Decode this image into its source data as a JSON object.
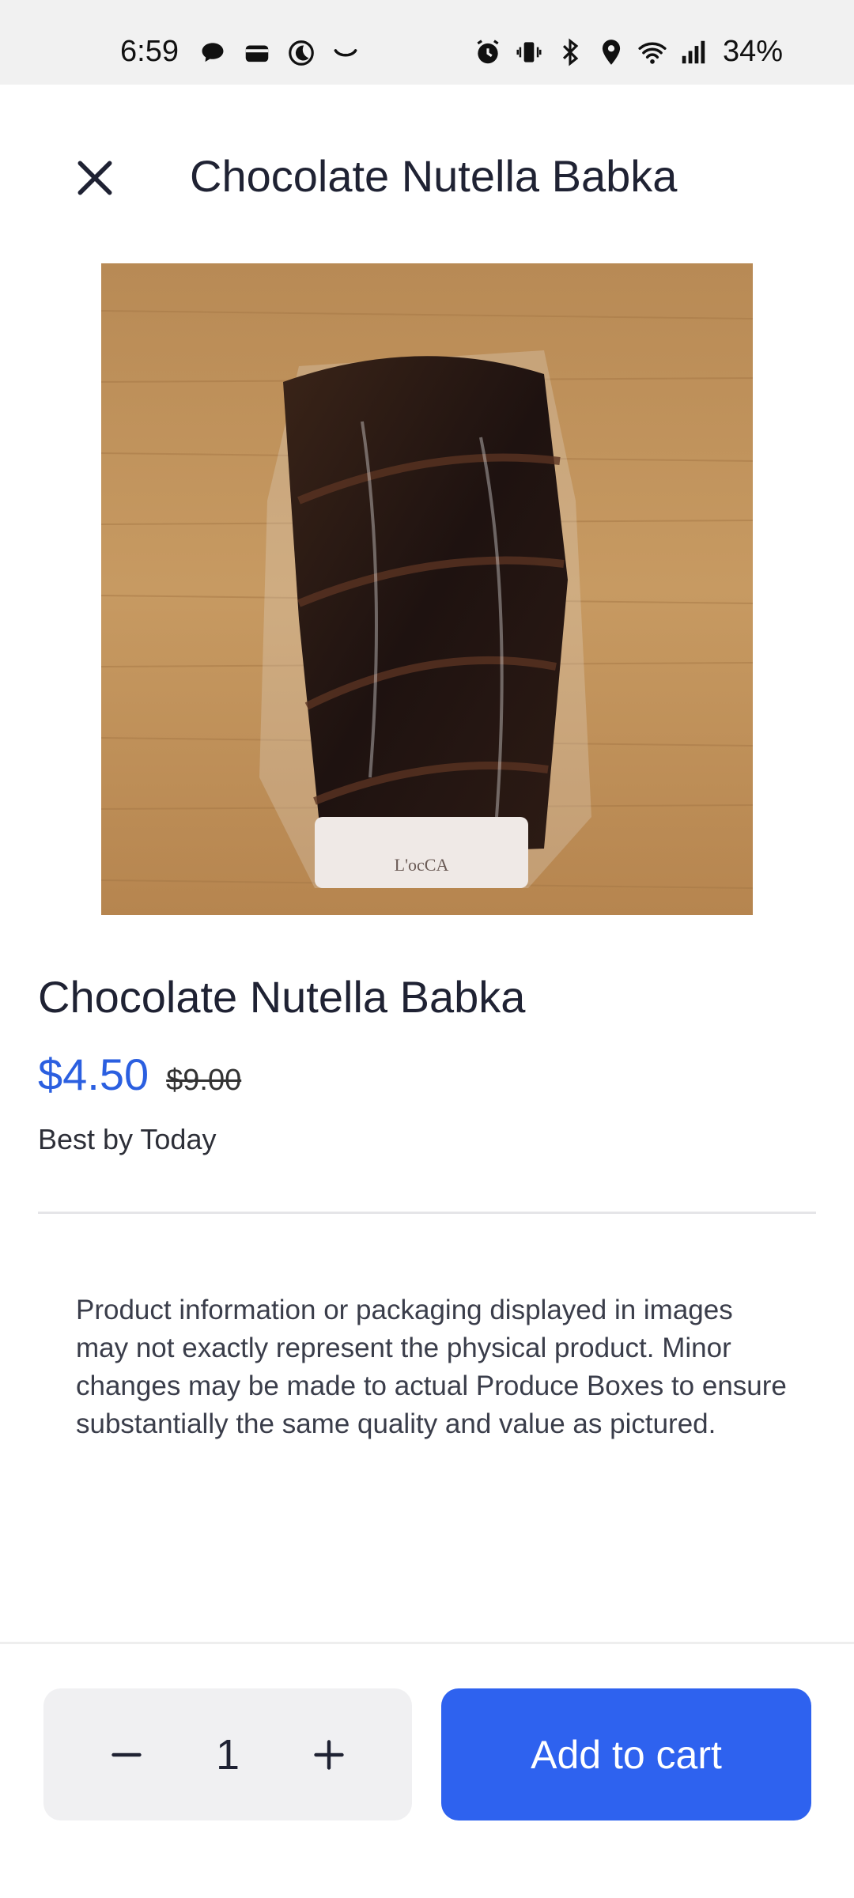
{
  "status_bar": {
    "time": "6:59",
    "battery": "34%",
    "left_icons": [
      "chat-bubble-icon",
      "wallet-icon",
      "moon-icon",
      "smile-icon"
    ],
    "right_icons": [
      "alarm-icon",
      "vibrate-icon",
      "bluetooth-icon",
      "location-icon",
      "wifi-icon",
      "signal-icon"
    ]
  },
  "header": {
    "title": "Chocolate Nutella Babka",
    "close_icon": "close-icon"
  },
  "product": {
    "name": "Chocolate Nutella Babka",
    "price": "$4.50",
    "original_price": "$9.00",
    "best_by": "Best by Today",
    "image_label": "L'ocCA"
  },
  "disclaimer": "Product information or packaging displayed in images may not exactly represent the physical product. Minor changes may be made to actual Produce Boxes to ensure substantially the same quality and value as pictured.",
  "footer": {
    "quantity": "1",
    "add_to_cart_label": "Add to cart",
    "decrease_icon": "minus-icon",
    "increase_icon": "plus-icon"
  },
  "colors": {
    "accent": "#2e62ef",
    "price": "#2b5fe0",
    "text": "#1f2233"
  }
}
